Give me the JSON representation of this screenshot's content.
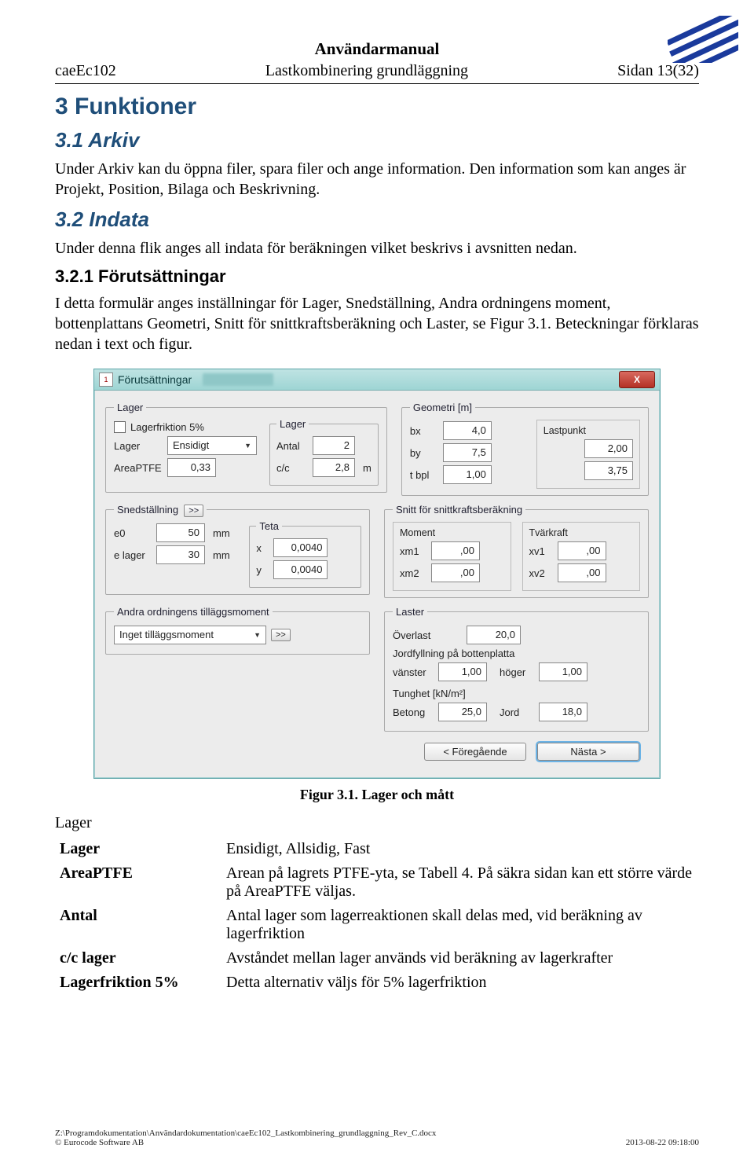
{
  "header": {
    "doc_title": "Användarmanual",
    "left": "caeEc102",
    "center": "Lastkombinering grundläggning",
    "right": "Sidan 13(32)"
  },
  "sections": {
    "h1": "3  Funktioner",
    "h2a": "3.1  Arkiv",
    "p1": "Under Arkiv kan du öppna filer, spara filer och ange information. Den information som kan anges är Projekt, Position, Bilaga och Beskrivning.",
    "h2b": "3.2  Indata",
    "p2": "Under denna flik anges all indata för beräkningen vilket beskrivs i avsnitten nedan.",
    "h3": "3.2.1  Förutsättningar",
    "p3": "I detta formulär anges inställningar för Lager, Snedställning, Andra ordningens moment, bottenplattans Geometri, Snitt för snittkraftsberäkning och Laster, se Figur 3.1. Beteckningar förklaras nedan i text och figur."
  },
  "dialog": {
    "title": "Förutsättningar",
    "icon": "1",
    "close": "X",
    "lager": {
      "legend": "Lager",
      "chk_label": "Lagerfriktion 5%",
      "lager_label": "Lager",
      "lager_value": "Ensidigt",
      "area_label": "AreaPTFE",
      "area_value": "0,33",
      "sub": {
        "legend": "Lager",
        "antal_label": "Antal",
        "antal_value": "2",
        "cc_label": "c/c",
        "cc_value": "2,8",
        "cc_unit": "m"
      }
    },
    "geom": {
      "legend": "Geometri [m]",
      "bx_label": "bx",
      "bx_value": "4,0",
      "by_label": "by",
      "by_value": "7,5",
      "tbpl_label": "t bpl",
      "tbpl_value": "1,00",
      "lp_title": "Lastpunkt",
      "lp1": "2,00",
      "lp2": "3,75"
    },
    "sned": {
      "legend": "Snedställning",
      "btn": ">>",
      "e0_label": "e0",
      "e0_value": "50",
      "e0_unit": "mm",
      "el_label": "e lager",
      "el_value": "30",
      "el_unit": "mm",
      "teta_legend": "Teta",
      "x_label": "x",
      "x_value": "0,0040",
      "y_label": "y",
      "y_value": "0,0040"
    },
    "snitt": {
      "legend": "Snitt för snittkraftsberäkning",
      "m_title": "Moment",
      "t_title": "Tvärkraft",
      "xm1_label": "xm1",
      "xm1_value": ",00",
      "xm2_label": "xm2",
      "xm2_value": ",00",
      "xv1_label": "xv1",
      "xv1_value": ",00",
      "xv2_label": "xv2",
      "xv2_value": ",00"
    },
    "andra": {
      "legend": "Andra ordningens tilläggsmoment",
      "value": "Inget tilläggsmoment",
      "btn": ">>"
    },
    "laster": {
      "legend": "Laster",
      "overlast_label": "Överlast",
      "overlast_value": "20,0",
      "jord_label": "Jordfyllning på bottenplatta",
      "v_label": "vänster",
      "v_value": "1,00",
      "h_label": "höger",
      "h_value": "1,00",
      "tung_label": "Tunghet [kN/m²]",
      "betong_label": "Betong",
      "betong_value": "25,0",
      "jord2_label": "Jord",
      "jord2_value": "18,0"
    },
    "buttons": {
      "prev": "< Föregående",
      "next": "Nästa >"
    }
  },
  "caption": "Figur 3.1. Lager och mått",
  "defs": {
    "group_title": "Lager",
    "rows": [
      {
        "term": "Lager",
        "def": "Ensidigt, Allsidig, Fast"
      },
      {
        "term": "AreaPTFE",
        "def": "Arean på lagrets PTFE-yta, se Tabell 4. På säkra sidan kan ett större värde på AreaPTFE väljas."
      },
      {
        "term": "Antal",
        "def": "Antal lager som lagerreaktionen skall delas med, vid beräkning av lagerfriktion"
      },
      {
        "term": "c/c lager",
        "def": "Avståndet mellan lager används vid beräkning av lagerkrafter"
      },
      {
        "term": "Lagerfriktion 5%",
        "def": "Detta alternativ väljs för 5% lagerfriktion"
      }
    ]
  },
  "footer": {
    "path": "Z:\\Programdokumentation\\Användardokumentation\\caeEc102_Lastkombinering_grundlaggning_Rev_C.docx",
    "copyright": "© Eurocode Software AB",
    "date": "2013-08-22 09:18:00"
  }
}
